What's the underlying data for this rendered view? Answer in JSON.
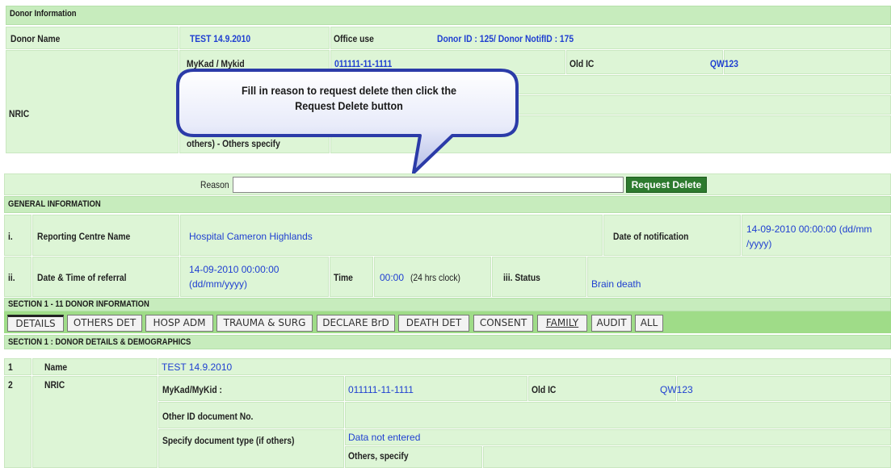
{
  "donor_section": {
    "header": "Donor Information",
    "donor_name_label": "Donor Name",
    "donor_name_value": "TEST 14.9.2010",
    "office_use_label": "Office use",
    "donor_id_value": "Donor ID : 125/ Donor NotifID : 175",
    "nric_label": "NRIC",
    "mykad_label": "MyKad / Mykid",
    "mykad_value": "011111-11-1111",
    "old_ic_label": "Old IC",
    "old_ic_value": "QW123",
    "others_specify_label": "others) - Others specify"
  },
  "callout": {
    "line1": "Fill in reason to request delete then click the",
    "line2": "Request Delete button"
  },
  "reason_bar": {
    "label": "Reason",
    "input_value": "",
    "button_label": "Request Delete"
  },
  "general_info": {
    "header": "GENERAL INFORMATION",
    "row1_num": "i.",
    "reporting_centre_label": "Reporting Centre Name",
    "reporting_centre_value": "Hospital Cameron Highlands",
    "date_notif_label": "Date of notification",
    "date_notif_value_line1": "14-09-2010 00:00:00  (dd/mm",
    "date_notif_value_line2": "/yyyy)",
    "row2_num": "ii.",
    "referral_label": "Date & Time of referral",
    "referral_value_line1": "14-09-2010 00:00:00",
    "referral_value_line2": "(dd/mm/yyyy)",
    "time_label": "Time",
    "time_value": "00:00",
    "time_suffix": "(24 hrs clock)",
    "status_label": "iii. Status",
    "status_value": "Brain death"
  },
  "section_header": "SECTION 1 - 11 DONOR INFORMATION",
  "tabs": [
    {
      "label": "DETAILS"
    },
    {
      "label": "OTHERS DET"
    },
    {
      "label": "HOSP ADM"
    },
    {
      "label": "TRAUMA & SURG"
    },
    {
      "label": "DECLARE BrD"
    },
    {
      "label": "DEATH DET"
    },
    {
      "label": "CONSENT"
    },
    {
      "label": "FAMILY"
    },
    {
      "label": "AUDIT"
    },
    {
      "label": "ALL"
    }
  ],
  "details": {
    "header": "SECTION 1 : DONOR DETAILS & DEMOGRAPHICS",
    "row1_num": "1",
    "name_label": "Name",
    "name_value": "TEST 14.9.2010",
    "row2_num": "2",
    "nric_label": "NRIC",
    "mykad_label": "MyKad/MyKid :",
    "mykad_value": "011111-11-1111",
    "old_ic_label": "Old IC",
    "old_ic_value": "QW123",
    "other_id_label": "Other ID document No.",
    "specify_doc_label": "Specify document type (if others)",
    "specify_doc_value": "Data not entered",
    "others_specify_label": "Others, specify"
  },
  "colors": {
    "cell_bg": "#ddf5d6",
    "header_bg": "#c7ecbd",
    "tab_bar": "#9fdc88",
    "value_blue": "#1f3fd1",
    "button_green": "#2d7a2e",
    "callout_blue": "#2b3ba8"
  }
}
